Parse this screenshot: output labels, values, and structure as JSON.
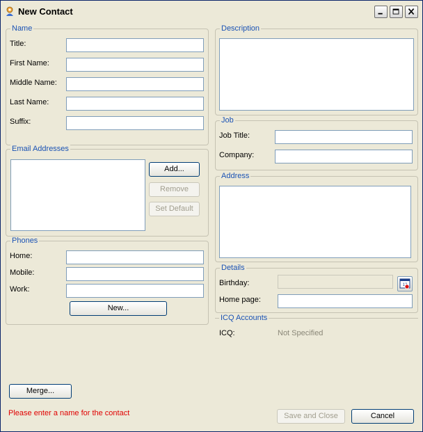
{
  "window": {
    "title": "New Contact"
  },
  "name_group": {
    "legend": "Name",
    "title_label": "Title:",
    "first_label": "First Name:",
    "middle_label": "Middle Name:",
    "last_label": "Last Name:",
    "suffix_label": "Suffix:",
    "title_value": "",
    "first_value": "",
    "middle_value": "",
    "last_value": "",
    "suffix_value": ""
  },
  "email_group": {
    "legend": "Email Addresses",
    "add_label": "Add...",
    "remove_label": "Remove",
    "set_default_label": "Set Default"
  },
  "phones_group": {
    "legend": "Phones",
    "home_label": "Home:",
    "mobile_label": "Mobile:",
    "work_label": "Work:",
    "new_label": "New..."
  },
  "description_group": {
    "legend": "Description"
  },
  "job_group": {
    "legend": "Job",
    "job_title_label": "Job Title:",
    "company_label": "Company:"
  },
  "address_group": {
    "legend": "Address"
  },
  "details_group": {
    "legend": "Details",
    "birthday_label": "Birthday:",
    "homepage_label": "Home page:",
    "calendar_icon_text": "12"
  },
  "icq_group": {
    "legend": "ICQ Accounts",
    "icq_label": "ICQ:",
    "icq_value": "Not Specified"
  },
  "footer": {
    "merge_label": "Merge...",
    "error_message": "Please enter a name for the contact",
    "save_close_label": "Save and Close",
    "cancel_label": "Cancel"
  },
  "colors": {
    "accent": "#1a52b4",
    "error": "#e00000",
    "border": "#7f9db9"
  }
}
